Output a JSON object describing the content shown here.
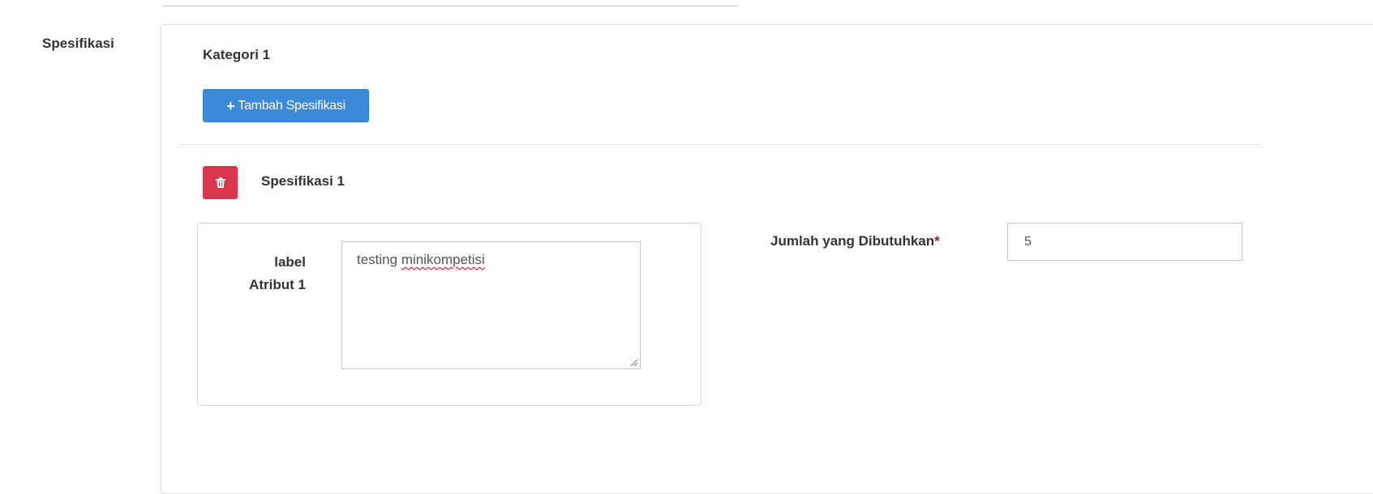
{
  "section": {
    "label": "Spesifikasi"
  },
  "kategori": {
    "title": "Kategori 1",
    "add_button_label": "Tambah Spesifikasi",
    "add_button_icon": "plus-icon"
  },
  "spesifikasi": {
    "title": "Spesifikasi 1",
    "delete_icon": "trash-icon",
    "attribute": {
      "label_line1": "label",
      "label_line2": "Atribut 1",
      "value_word1": "testing",
      "value_word2": "minikompetisi"
    },
    "quantity": {
      "label": "Jumlah yang Dibutuhkan",
      "required_marker": "*",
      "value": "5"
    }
  },
  "colors": {
    "primary_button": "#3b8ad9",
    "danger_button": "#d9374b",
    "required_marker": "#a3172b"
  }
}
